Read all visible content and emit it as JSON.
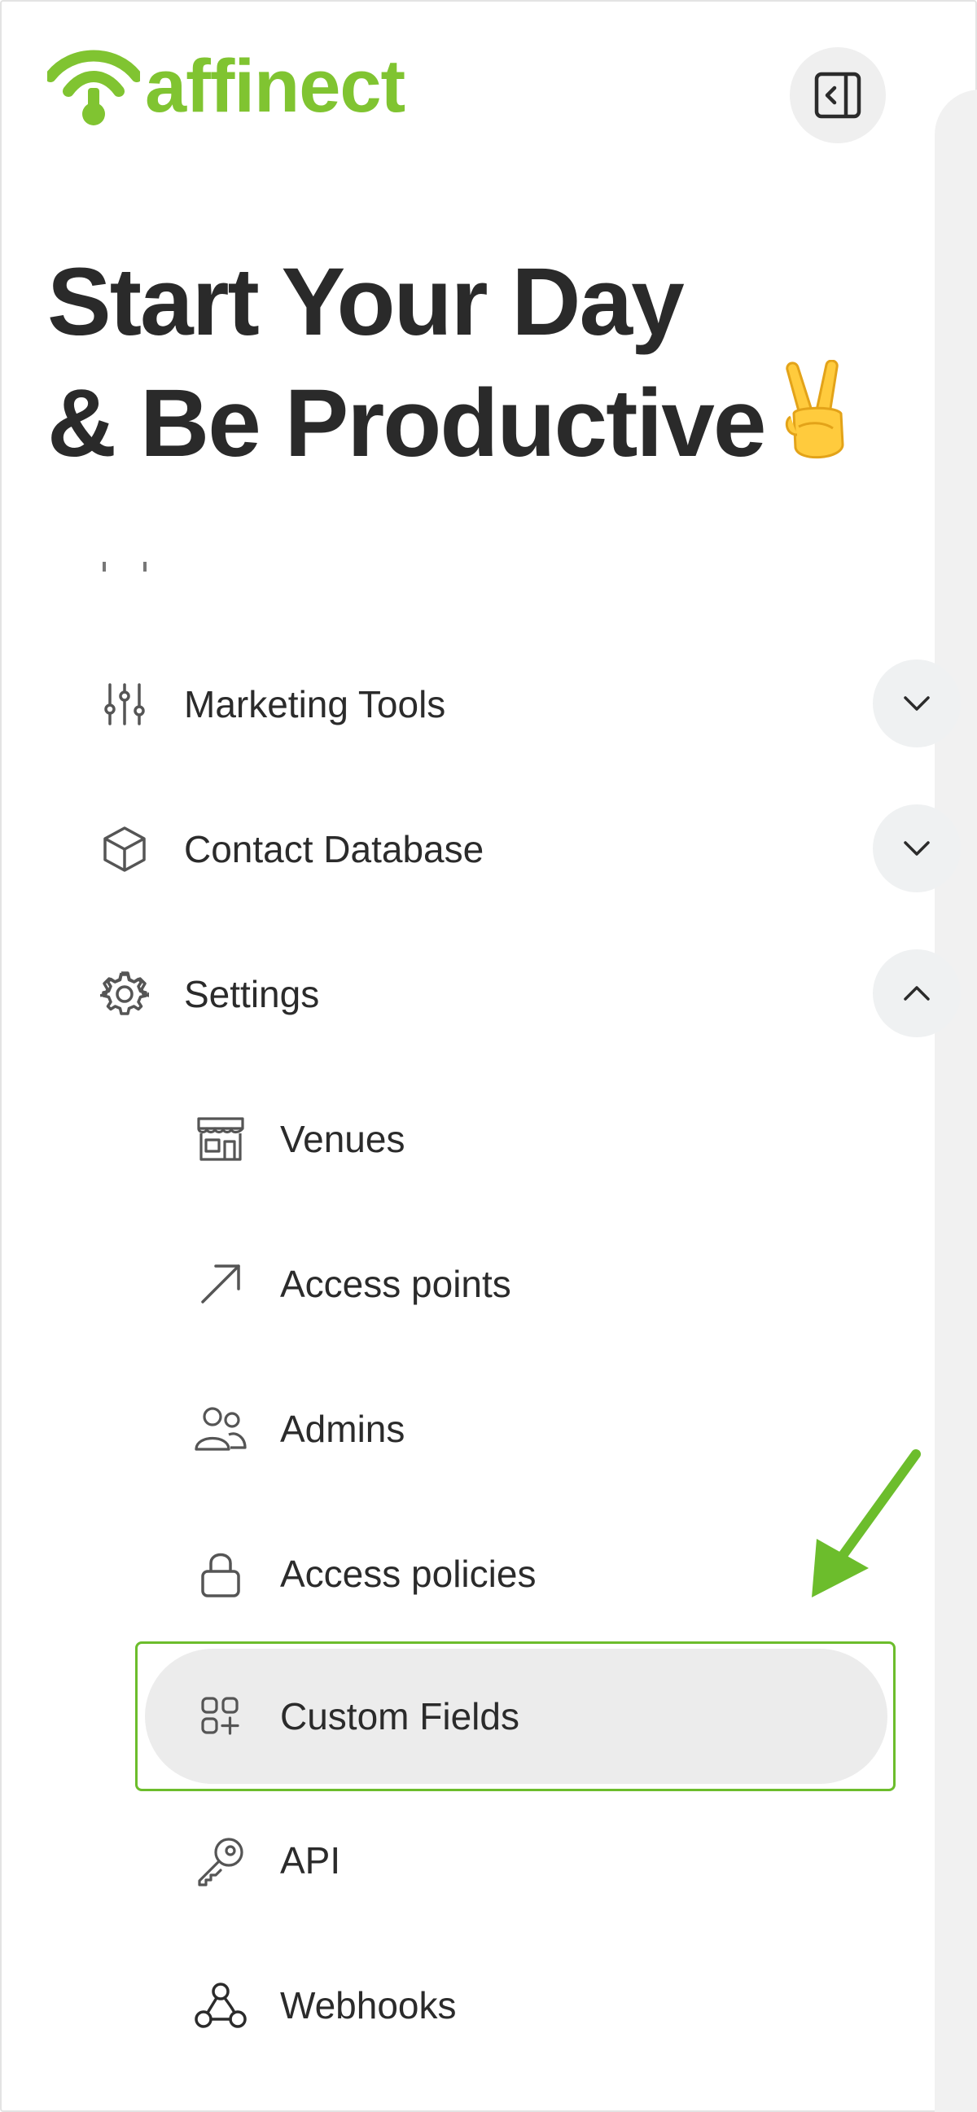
{
  "brand": {
    "name": "affinect",
    "color": "#80c431"
  },
  "header": {
    "collapse_icon": "sidebar-collapse-icon"
  },
  "hero": {
    "line1": "Start Your Day",
    "line2": "& Be Productive",
    "emoji": "victory-hand-emoji"
  },
  "nav": {
    "items": [
      {
        "label": "Marketing Tools",
        "icon": "sliders-icon",
        "expanded": false
      },
      {
        "label": "Contact Database",
        "icon": "cube-icon",
        "expanded": false
      },
      {
        "label": "Settings",
        "icon": "gear-icon",
        "expanded": true
      }
    ],
    "settings_children": [
      {
        "label": "Venues",
        "icon": "storefront-icon"
      },
      {
        "label": "Access points",
        "icon": "arrow-up-right-icon"
      },
      {
        "label": "Admins",
        "icon": "users-icon"
      },
      {
        "label": "Access policies",
        "icon": "lock-icon"
      },
      {
        "label": "Custom Fields",
        "icon": "grid-plus-icon",
        "active": true
      },
      {
        "label": "API",
        "icon": "key-icon"
      },
      {
        "label": "Webhooks",
        "icon": "webhook-icon"
      }
    ]
  },
  "annotation": {
    "highlight_color": "#6cbd2c",
    "arrow_target": "Custom Fields"
  }
}
